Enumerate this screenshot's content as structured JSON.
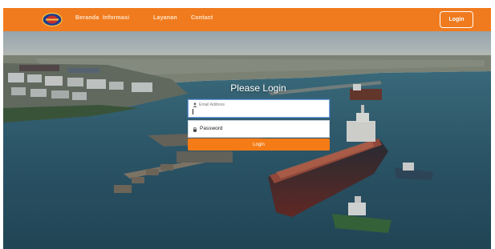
{
  "navbar": {
    "links": [
      "Beranda",
      "Informasi",
      "Layanan",
      "Contact"
    ],
    "login_label": "Login"
  },
  "login_form": {
    "title": "Please Login",
    "email_label": "Email Address",
    "password_placeholder": "Password",
    "submit_label": "Login"
  },
  "colors": {
    "brand_orange": "#f07b1e",
    "button_orange": "#f47b16",
    "sea": "#2f5f72"
  },
  "icons": {
    "email": "user-icon",
    "password": "lock-icon",
    "logo": "company-logo"
  }
}
